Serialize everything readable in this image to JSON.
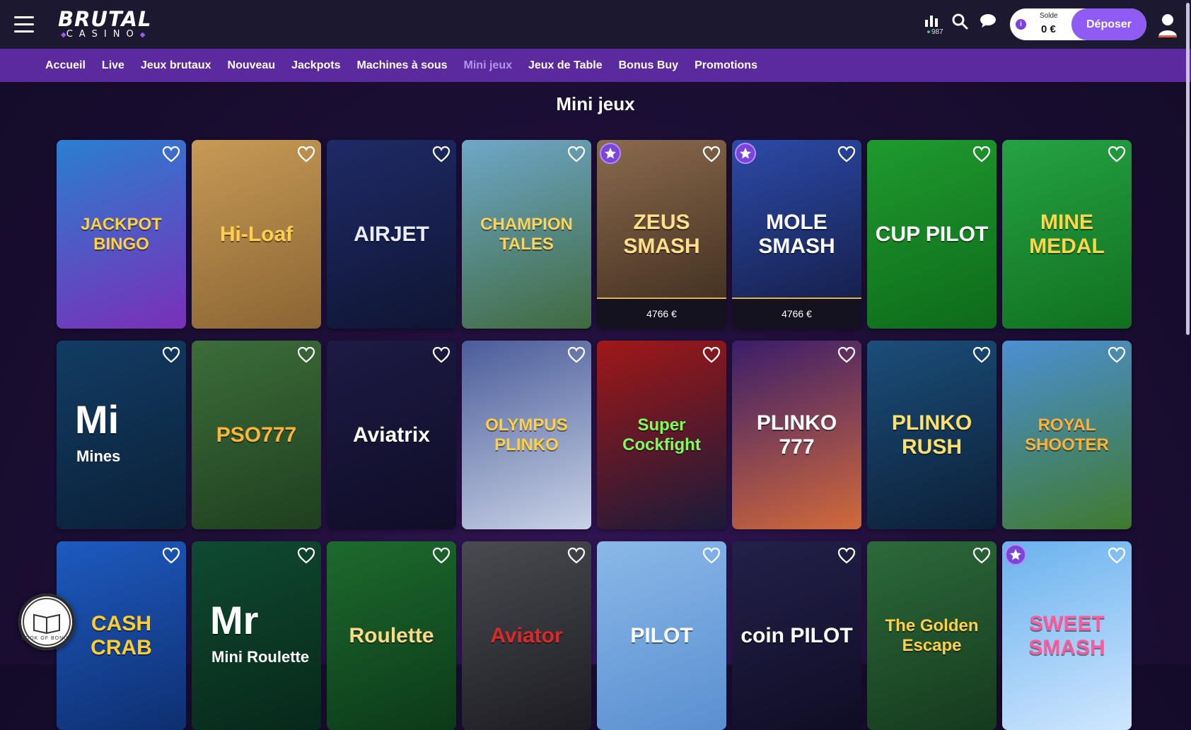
{
  "header": {
    "logo_top": "BRUTAL",
    "logo_bottom": "CASINO",
    "players_count": "987",
    "balance_label": "Solde",
    "balance_value": "0 €",
    "deposit_label": "Déposer"
  },
  "nav": {
    "items": [
      {
        "label": "Accueil"
      },
      {
        "label": "Live"
      },
      {
        "label": "Jeux brutaux"
      },
      {
        "label": "Nouveau"
      },
      {
        "label": "Jackpots"
      },
      {
        "label": "Machines à sous"
      },
      {
        "label": "Mini jeux"
      },
      {
        "label": "Jeux de Table"
      },
      {
        "label": "Bonus Buy"
      },
      {
        "label": "Promotions"
      }
    ],
    "active": "Mini jeux"
  },
  "page": {
    "title": "Mini jeux"
  },
  "games": [
    {
      "title": "JACKPOT BINGO",
      "bg": "#2a7fd1",
      "bg2": "#7a2fb8",
      "fg": "#ffd23a"
    },
    {
      "title": "Hi-Loaf",
      "bg": "#c79a55",
      "bg2": "#8a6433",
      "fg": "#ffcf4d"
    },
    {
      "title": "AIRJET",
      "bg": "#1f2a66",
      "bg2": "#0f1533",
      "fg": "#e8eeff"
    },
    {
      "title": "CHAMPION TALES",
      "bg": "#6fa7c9",
      "bg2": "#3f6a3f",
      "fg": "#ffd25a"
    },
    {
      "title": "ZEUS SMASH",
      "bg": "#8a6a4d",
      "bg2": "#3b2a1c",
      "fg": "#ffe08a",
      "jackpot": "4766 €",
      "star": true
    },
    {
      "title": "MOLE SMASH",
      "bg": "#2c4aa8",
      "bg2": "#121a40",
      "fg": "#ffffff",
      "jackpot": "4766 €",
      "star": true
    },
    {
      "title": "CUP PILOT",
      "bg": "#1f9a2e",
      "bg2": "#0e6a1a",
      "fg": "#ffffff"
    },
    {
      "title": "MINE MEDAL",
      "bg": "#25a243",
      "bg2": "#11701f",
      "fg": "#ffd54a"
    },
    {
      "title": "Mi",
      "sub": "Mines",
      "bg": "#123c63",
      "bg2": "#0b2038",
      "fg": "#ffffff"
    },
    {
      "title": "PSO777",
      "bg": "#3c6d3a",
      "bg2": "#1f3f1e",
      "fg": "#ffb43a"
    },
    {
      "title": "Aviatrix",
      "bg": "#1d1a45",
      "bg2": "#0f0d26",
      "fg": "#ffffff"
    },
    {
      "title": "OLYMPUS PLINKO",
      "bg": "#4a5c9a",
      "bg2": "#c9d2e6",
      "fg": "#ffd03f"
    },
    {
      "title": "Super Cockfight",
      "bg": "#a01818",
      "bg2": "#1a1a3a",
      "fg": "#7bff5a"
    },
    {
      "title": "PLINKO 777",
      "bg": "#3a1d6a",
      "bg2": "#d26a3a",
      "fg": "#ffffff"
    },
    {
      "title": "PLINKO RUSH",
      "bg": "#1b4e7a",
      "bg2": "#0c1e36",
      "fg": "#ffe16a"
    },
    {
      "title": "ROYAL SHOOTER",
      "bg": "#4c8fd4",
      "bg2": "#3f7a2e",
      "fg": "#ffb13a"
    },
    {
      "title": "CASH CRAB",
      "bg": "#1e5ac0",
      "bg2": "#0e2f70",
      "fg": "#ffce2e"
    },
    {
      "title": "Mr",
      "sub": "Mini Roulette",
      "bg": "#0f4a32",
      "bg2": "#07281a",
      "fg": "#ffffff"
    },
    {
      "title": "Roulette",
      "bg": "#1d6a2e",
      "bg2": "#0c3a18",
      "fg": "#ffd88a"
    },
    {
      "title": "Aviator",
      "bg": "#4a4a52",
      "bg2": "#1c1c22",
      "fg": "#d92a2a"
    },
    {
      "title": "PILOT",
      "bg": "#8ab8e8",
      "bg2": "#5a8fd0",
      "fg": "#ffffff"
    },
    {
      "title": "coin PILOT",
      "bg": "#23204a",
      "bg2": "#0f0d24",
      "fg": "#ffffff"
    },
    {
      "title": "The Golden Escape",
      "bg": "#2d6a3a",
      "bg2": "#153a1e",
      "fg": "#ffcf4a"
    },
    {
      "title": "SWEET SMASH",
      "bg": "#6ab2ee",
      "bg2": "#cfe6ff",
      "fg": "#ff5a9a",
      "star": true
    }
  ],
  "book_badge": "BOOK OF BONUS"
}
